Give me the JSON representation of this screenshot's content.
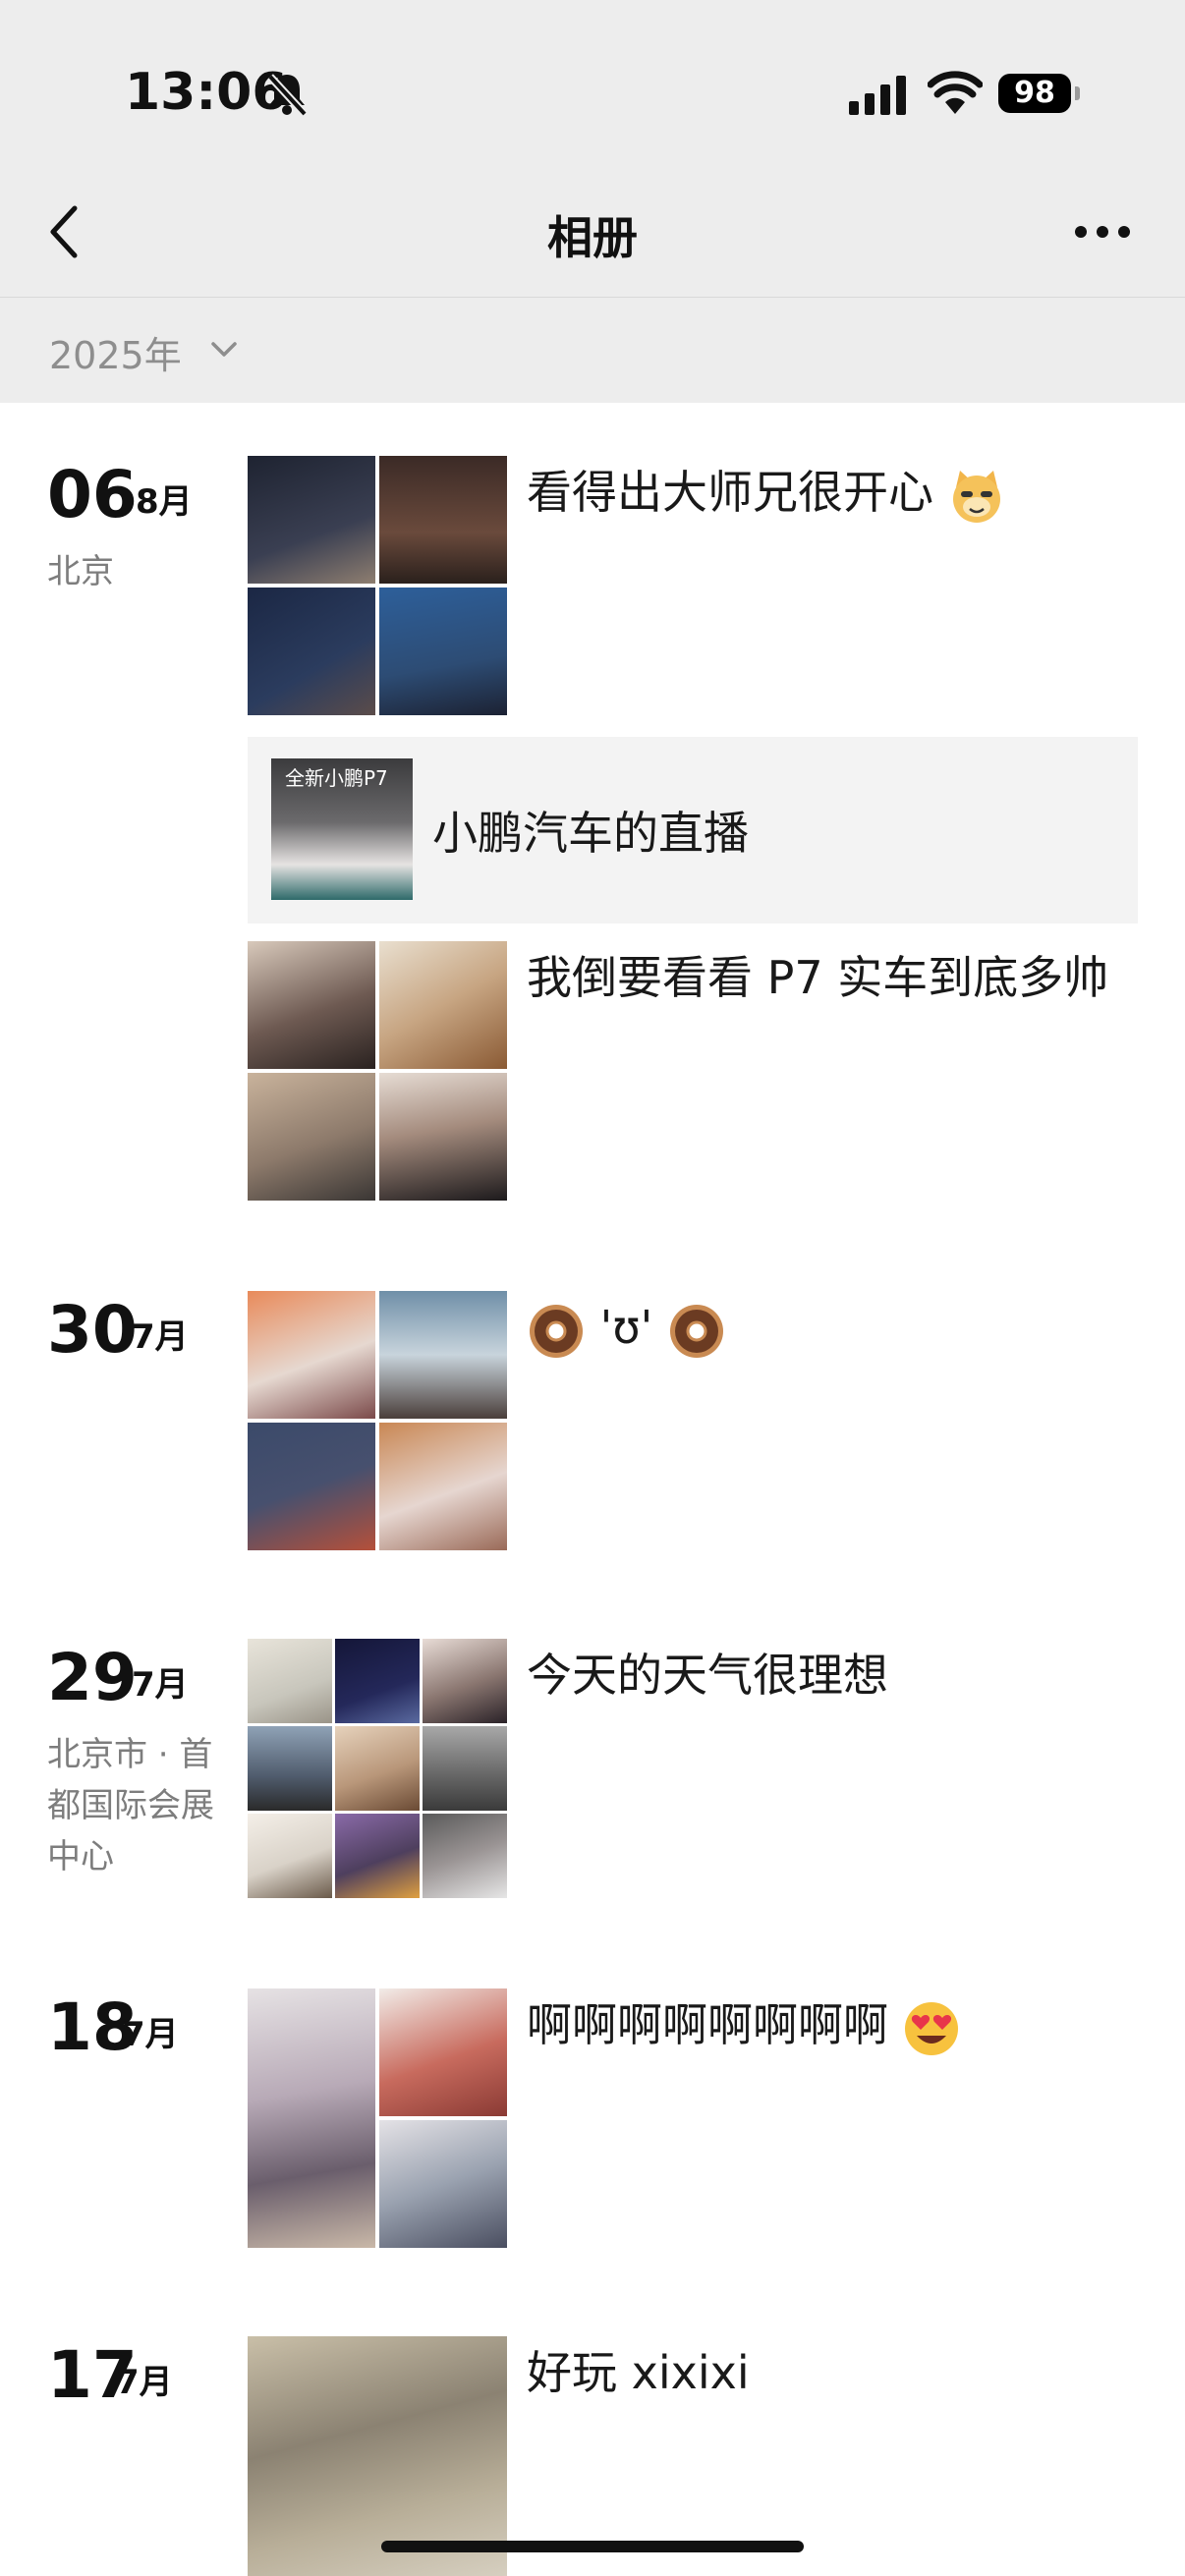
{
  "status_bar": {
    "time": "13:06",
    "battery": "98"
  },
  "nav": {
    "title": "相册"
  },
  "year_filter": {
    "label": "2025年"
  },
  "entries": [
    {
      "day": "06",
      "month": "8月",
      "location": "北京",
      "caption": "看得出大师兄很开心",
      "tile_colors": [
        "#3a3f52",
        "#5a3e34",
        "#2b3c5e",
        "#2d4c74"
      ]
    },
    {
      "share_title": "小鹏汽车的直播",
      "share_thumb_text": "全新小鹏P7"
    },
    {
      "caption": "我倒要看看 P7 实车到底多帅",
      "tile_colors": [
        "#a08c7f",
        "#c7a582",
        "#8d7a6b",
        "#d6c7bc"
      ]
    },
    {
      "day": "30",
      "month": "7月",
      "caption": "'ʊ'",
      "tile_colors": [
        "#c9a584",
        "#6f8fa8",
        "#47506e",
        "#c98754"
      ]
    },
    {
      "day": "29",
      "month": "7月",
      "location": "北京市 · 首都国际会展中心",
      "caption": "今天的天气很理想",
      "tile_colors": [
        "#c8c6bc",
        "#24285a",
        "#8a7670",
        "#4f5b6c",
        "#b9977a",
        "#6a6a6a",
        "#d9d2c8",
        "#4e3f5e",
        "#9a9494"
      ]
    },
    {
      "day": "18",
      "month": "7月",
      "caption": "啊啊啊啊啊啊啊啊",
      "tile_colors": [
        "#b8aab7",
        "#c86b5e",
        "#9aa2b0"
      ]
    },
    {
      "day": "17",
      "month": "7月",
      "caption": "好玩 xixixi",
      "tile_colors": [
        "#8b8272"
      ]
    }
  ]
}
